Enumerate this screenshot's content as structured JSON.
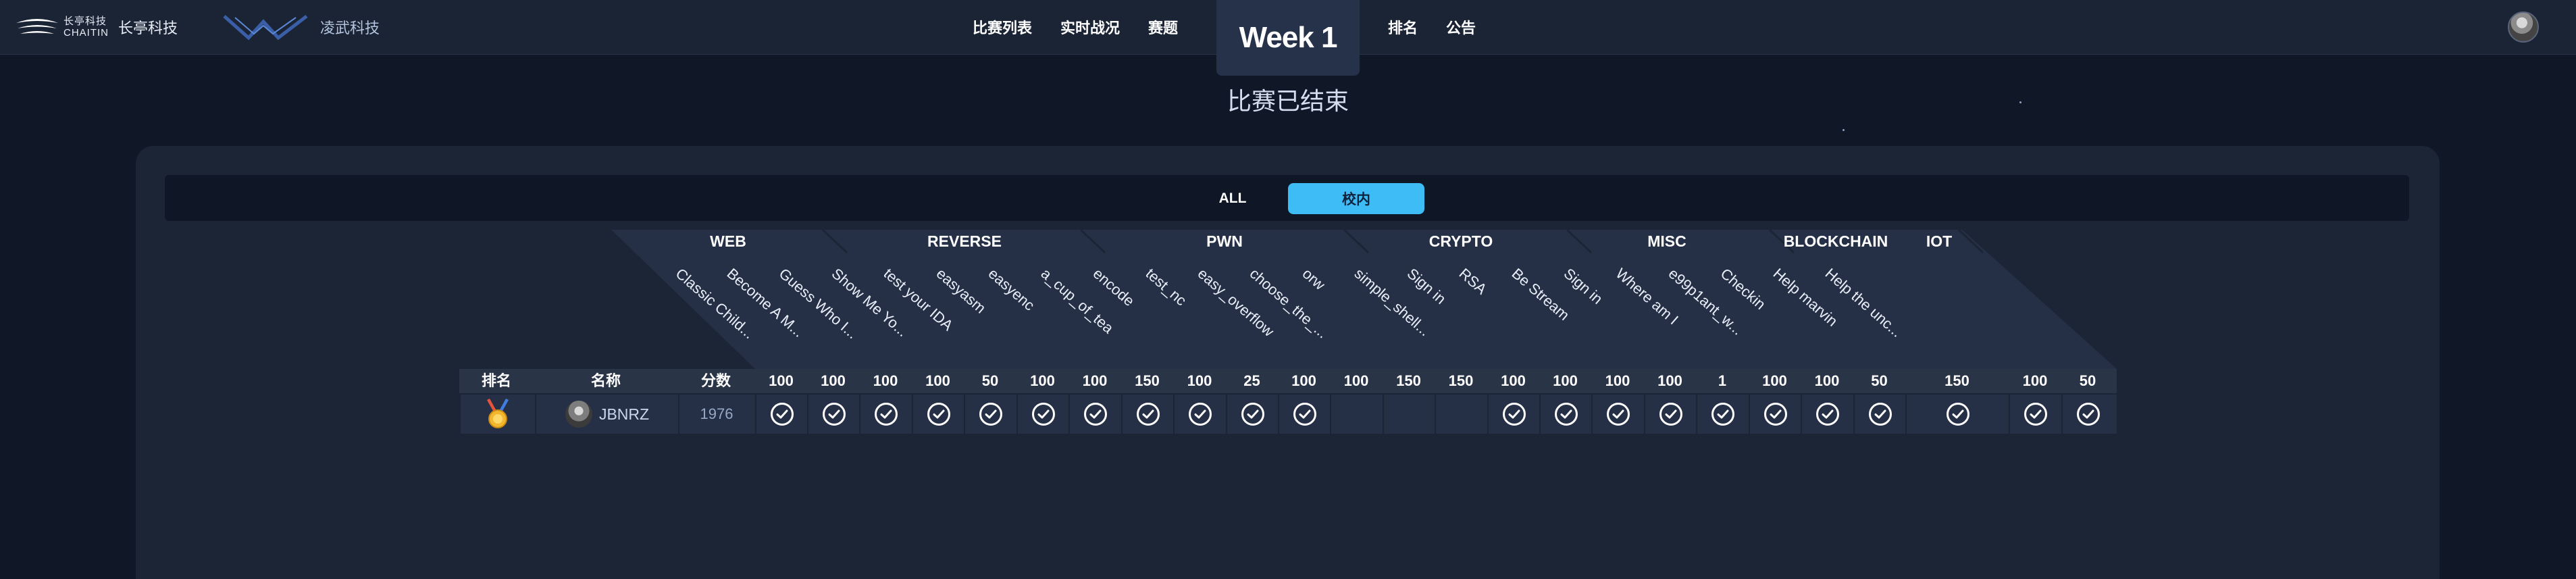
{
  "nav": {
    "brand1_line1": "长亭科技",
    "brand1_line2": "CHAITIN",
    "brand1_name": "长亭科技",
    "brand2_name": "凌武科技",
    "links_left": [
      "比赛列表",
      "实时战况",
      "赛题"
    ],
    "week_label": "Week 1",
    "links_right": [
      "排名",
      "公告"
    ]
  },
  "status_title": "比赛已结束",
  "filters": {
    "all": "ALL",
    "campus": "校内",
    "active": "校内"
  },
  "categories": [
    {
      "name": "WEB"
    },
    {
      "name": "REVERSE"
    },
    {
      "name": "PWN"
    },
    {
      "name": "CRYPTO"
    },
    {
      "name": "MISC"
    },
    {
      "name": "BLOCKCHAIN"
    },
    {
      "name": "IOT"
    }
  ],
  "challenges": [
    "Classic Child...",
    "Become A M...",
    "Guess Who I...",
    "Show Me Yo...",
    "test your IDA",
    "easyasm",
    "easyenc",
    "a_cup_of_tea",
    "encode",
    "test_nc",
    "easy_overflow",
    "choose_the_...",
    "orw",
    "simple_shell...",
    "Sign in",
    "RSA",
    "Be Stream",
    "Sign in",
    "Where am I",
    "e99p1ant_w...",
    "Checkin",
    "Help marvin",
    "Help the unc..."
  ],
  "table": {
    "headers": {
      "rank": "排名",
      "name": "名称",
      "score": "分数"
    },
    "points": [
      100,
      100,
      100,
      100,
      50,
      100,
      100,
      150,
      100,
      25,
      100,
      100,
      150,
      150,
      100,
      100,
      100,
      100,
      1,
      100,
      100,
      50,
      150,
      100,
      50
    ],
    "rows": [
      {
        "rank_icon": "gold-medal-icon",
        "name": "JBNRZ",
        "score": "1976",
        "solved": [
          true,
          true,
          true,
          true,
          true,
          true,
          true,
          true,
          true,
          true,
          true,
          false,
          false,
          false,
          true,
          true,
          true,
          true,
          true,
          true,
          true,
          true,
          true,
          true,
          true
        ]
      }
    ]
  },
  "colors": {
    "background": "#101828",
    "topbar": "#1b2435",
    "accent": "#3ebcf5",
    "panel": "#1c2536"
  }
}
